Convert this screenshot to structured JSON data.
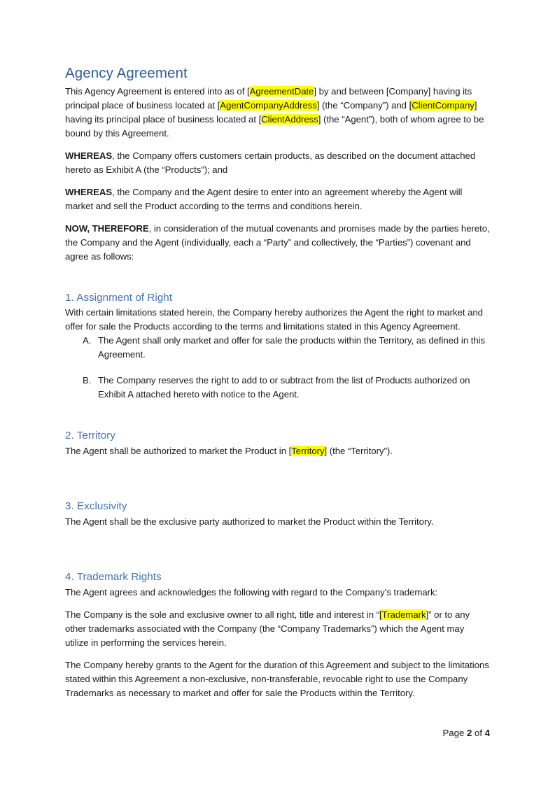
{
  "document": {
    "title": "Agency Agreement",
    "intro": {
      "p1_a": "This Agency Agreement is entered into as of [",
      "p1_hl1": "AgreementDate",
      "p1_b": "] by and between [Company] having its principal place of business located at [",
      "p1_hl2": "AgentCompanyAddress",
      "p1_c": "] (the “Company”) and ",
      "p1_hl3": "[ClientCompany",
      "p1_d": "] having its principal place of business located at [",
      "p1_hl4": "ClientAddress",
      "p1_e": "] (the “Agent”), both of whom agree to be bound by this Agreement."
    },
    "recitals": [
      {
        "lead": "WHEREAS",
        "text": ", the Company offers customers certain products, as described on the document attached hereto as Exhibit A (the “Products”); and"
      },
      {
        "lead": "WHEREAS",
        "text": ", the Company and the Agent desire to enter into an agreement whereby the Agent will market and sell the Product according to the terms and conditions herein."
      },
      {
        "lead": "NOW, THEREFORE",
        "text": ", in consideration of the mutual covenants and promises made by the parties hereto, the Company and the Agent (individually, each a “Party” and collectively, the “Parties”) covenant and agree as follows:"
      }
    ],
    "sections": [
      {
        "heading": "1. Assignment of Right",
        "body": "With certain limitations stated herein, the Company hereby authorizes the Agent the right to market and offer for sale the Products according to the terms and limitations stated in this Agency Agreement.",
        "list": [
          {
            "marker": "A.",
            "text": "The Agent shall only market and offer for sale the products within the Territory, as defined in this Agreement."
          },
          {
            "marker": "B.",
            "text": "The Company reserves the right to add to or subtract from the list of Products authorized on Exhibit A attached hereto with notice to the Agent."
          }
        ]
      },
      {
        "heading": "2. Territory",
        "body_a": "The Agent shall be authorized to market the Product in [",
        "body_hl": "Territory",
        "body_b": "] (the “Territory”)."
      },
      {
        "heading": "3. Exclusivity",
        "body": "The Agent shall be the exclusive party authorized to market the Product within the Territory."
      },
      {
        "heading": "4. Trademark Rights",
        "body1": "The Agent agrees and acknowledges the following with regard to the Company’s trademark:",
        "body2_a": "The Company is the sole and exclusive owner to all right, title and interest in “",
        "body2_hl": "[Trademark",
        "body2_b": "]” or to any other trademarks associated with the Company (the “Company Trademarks”) which the Agent may utilize in performing the services herein.",
        "body3": "The Company hereby grants to the Agent for the duration of this Agreement and subject to the limitations stated within this Agreement a non-exclusive, non-transferable, revocable right to use the Company Trademarks as necessary to market and offer for sale the Products within the Territory."
      }
    ],
    "footer": {
      "label_page": "Page",
      "current_page": "2",
      "label_of": "of",
      "total_pages": "4"
    },
    "colors": {
      "title_blue": "#2E5C9A",
      "heading_blue": "#4573AE",
      "highlight_yellow": "#FFFF00",
      "body_text": "#1a1a1a",
      "page_background": "#FFFFFF"
    }
  }
}
